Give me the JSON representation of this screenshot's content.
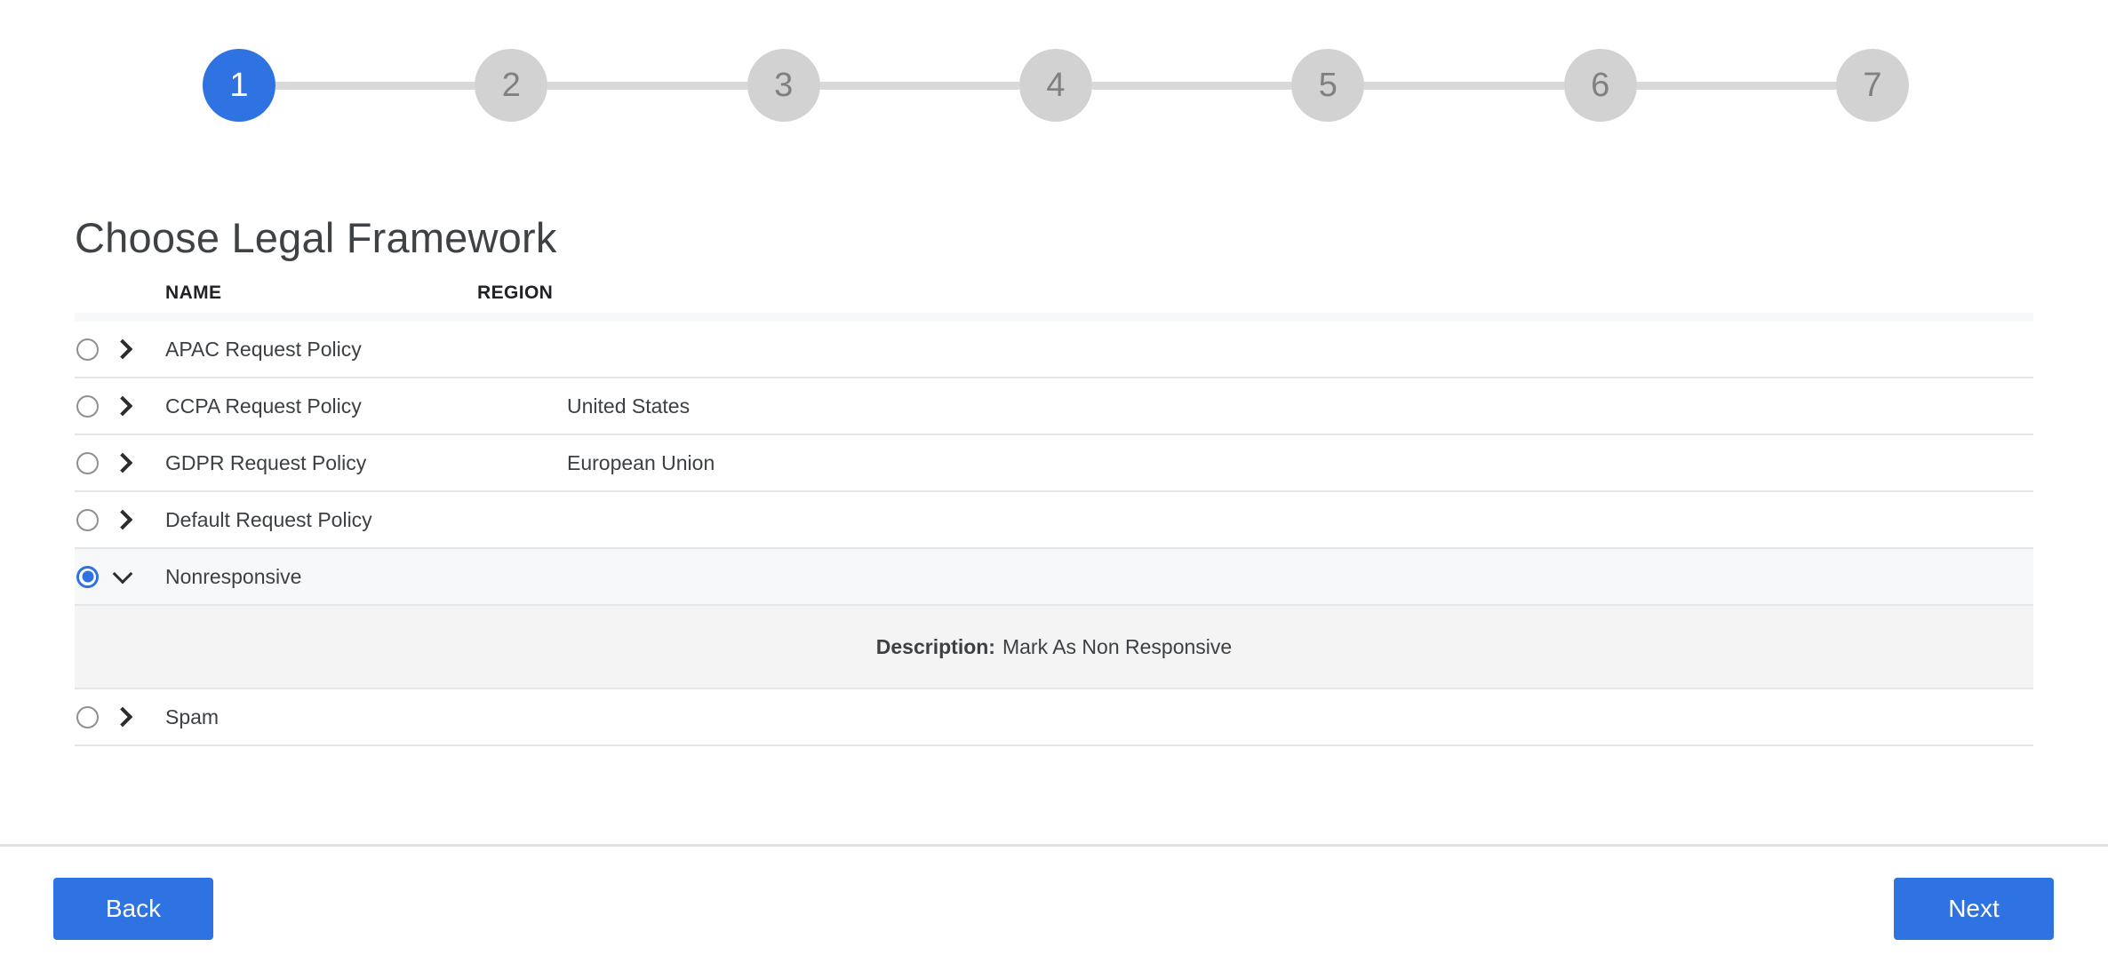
{
  "stepper": {
    "current": 1,
    "active_color": "#2f72e2",
    "inactive_color": "#d2d2d2",
    "steps": [
      {
        "label": "1"
      },
      {
        "label": "2"
      },
      {
        "label": "3"
      },
      {
        "label": "4"
      },
      {
        "label": "5"
      },
      {
        "label": "6"
      },
      {
        "label": "7"
      }
    ]
  },
  "page_title": "Choose Legal Framework",
  "table": {
    "columns": {
      "name": "NAME",
      "region": "REGION"
    },
    "rows": [
      {
        "name": "APAC Request Policy",
        "region": "",
        "selected": false,
        "expanded": false
      },
      {
        "name": "CCPA Request Policy",
        "region": "United States",
        "selected": false,
        "expanded": false
      },
      {
        "name": "GDPR Request Policy",
        "region": "European Union",
        "selected": false,
        "expanded": false
      },
      {
        "name": "Default Request Policy",
        "region": "",
        "selected": false,
        "expanded": false
      },
      {
        "name": "Nonresponsive",
        "region": "",
        "selected": true,
        "expanded": true,
        "description_label": "Description:",
        "description_value": "Mark As Non Responsive"
      },
      {
        "name": "Spam",
        "region": "",
        "selected": false,
        "expanded": false
      }
    ]
  },
  "footer": {
    "back_label": "Back",
    "next_label": "Next",
    "button_color": "#2f72e2"
  }
}
